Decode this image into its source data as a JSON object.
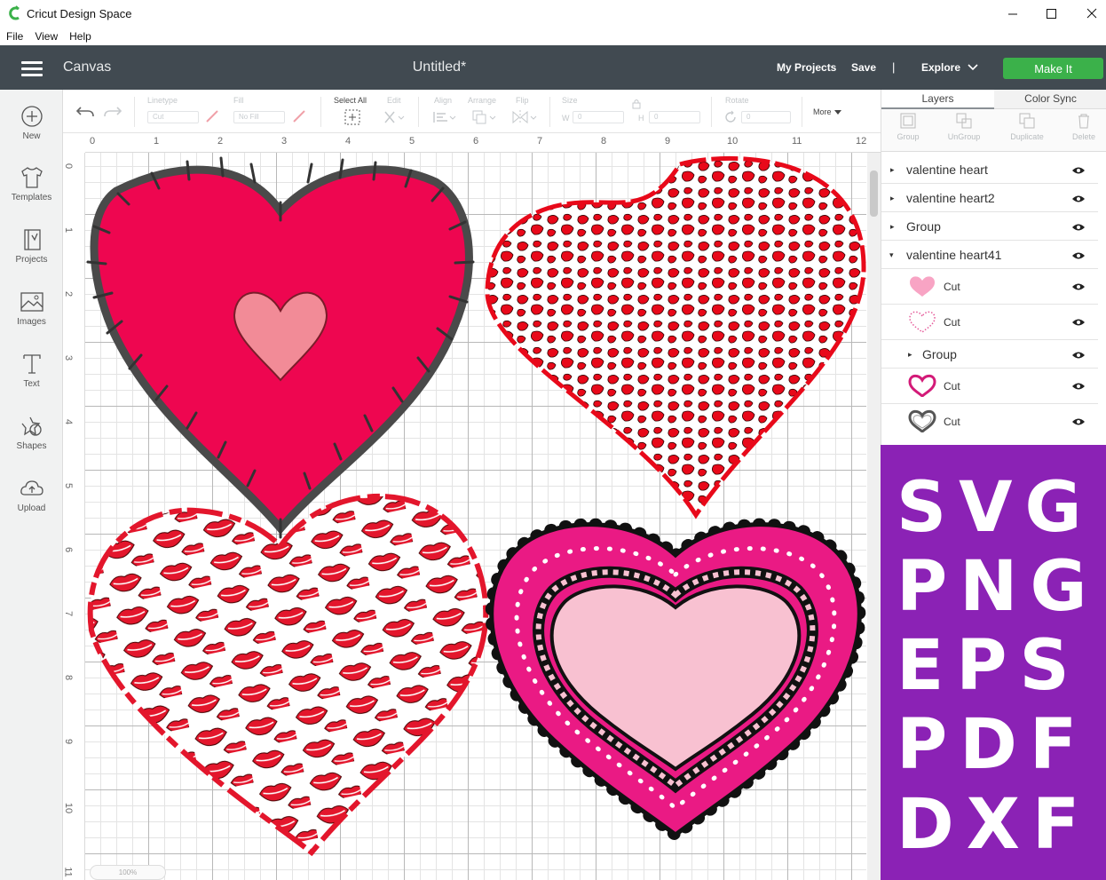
{
  "app": {
    "title": "Cricut Design Space",
    "window_controls": [
      "minimize",
      "maximize",
      "close"
    ]
  },
  "menu": [
    "File",
    "View",
    "Help"
  ],
  "header": {
    "section": "Canvas",
    "doc_title": "Untitled*",
    "my_projects": "My Projects",
    "save": "Save",
    "separator": "|",
    "explore": "Explore",
    "make_it": "Make It",
    "make_it_color": "#3bb14a"
  },
  "sidebar": [
    {
      "label": "New",
      "icon": "new-plus-icon"
    },
    {
      "label": "Templates",
      "icon": "tshirt-icon"
    },
    {
      "label": "Projects",
      "icon": "projects-icon"
    },
    {
      "label": "Images",
      "icon": "images-icon"
    },
    {
      "label": "Text",
      "icon": "text-icon"
    },
    {
      "label": "Shapes",
      "icon": "shapes-icon"
    },
    {
      "label": "Upload",
      "icon": "upload-icon"
    }
  ],
  "toolbar": {
    "linetype_label": "Linetype",
    "linetype_value": "Cut",
    "fill_label": "Fill",
    "fill_value": "No Fill",
    "select_all": "Select All",
    "edit": "Edit",
    "align": "Align",
    "arrange": "Arrange",
    "flip": "Flip",
    "size": "Size",
    "w": "W",
    "h": "H",
    "w_value": "0",
    "h_value": "0",
    "rotate": "Rotate",
    "rotate_value": "0",
    "more": "More"
  },
  "ruler": {
    "top": [
      "0",
      "1",
      "2",
      "3",
      "4",
      "5",
      "6",
      "7",
      "8",
      "9",
      "10",
      "11",
      "12"
    ],
    "left": [
      "0",
      "1",
      "2",
      "3",
      "4",
      "5",
      "6",
      "7",
      "8",
      "9",
      "10",
      "11"
    ]
  },
  "zoom": "100%",
  "panel": {
    "tabs": [
      "Layers",
      "Color Sync"
    ],
    "tools": [
      "Group",
      "UnGroup",
      "Duplicate",
      "Delete"
    ],
    "layers": [
      {
        "name": "valentine heart",
        "expanded": false
      },
      {
        "name": "valentine heart2",
        "expanded": false
      },
      {
        "name": "Group",
        "expanded": false
      },
      {
        "name": "valentine heart41",
        "expanded": true
      }
    ],
    "sublayers": [
      {
        "name": "Cut",
        "thumb": "pink-heart-thumb"
      },
      {
        "name": "Cut",
        "thumb": "dotted-heart-thumb"
      },
      {
        "name": "Group",
        "thumb": ""
      },
      {
        "name": "Cut",
        "thumb": "magenta-outline-heart-thumb"
      },
      {
        "name": "Cut",
        "thumb": "gray-outline-heart-thumb"
      }
    ]
  },
  "promo": {
    "formats": [
      "SVG",
      "PNG",
      "EPS",
      "PDF",
      "DXF"
    ],
    "bg_color": "#8b22b5"
  },
  "colors": {
    "header": "#414a51",
    "heart_red": "#ee0650",
    "heart_pink": "#f28b97",
    "heart_magenta": "#ea1a84",
    "light_pink": "#f8c1d1"
  }
}
